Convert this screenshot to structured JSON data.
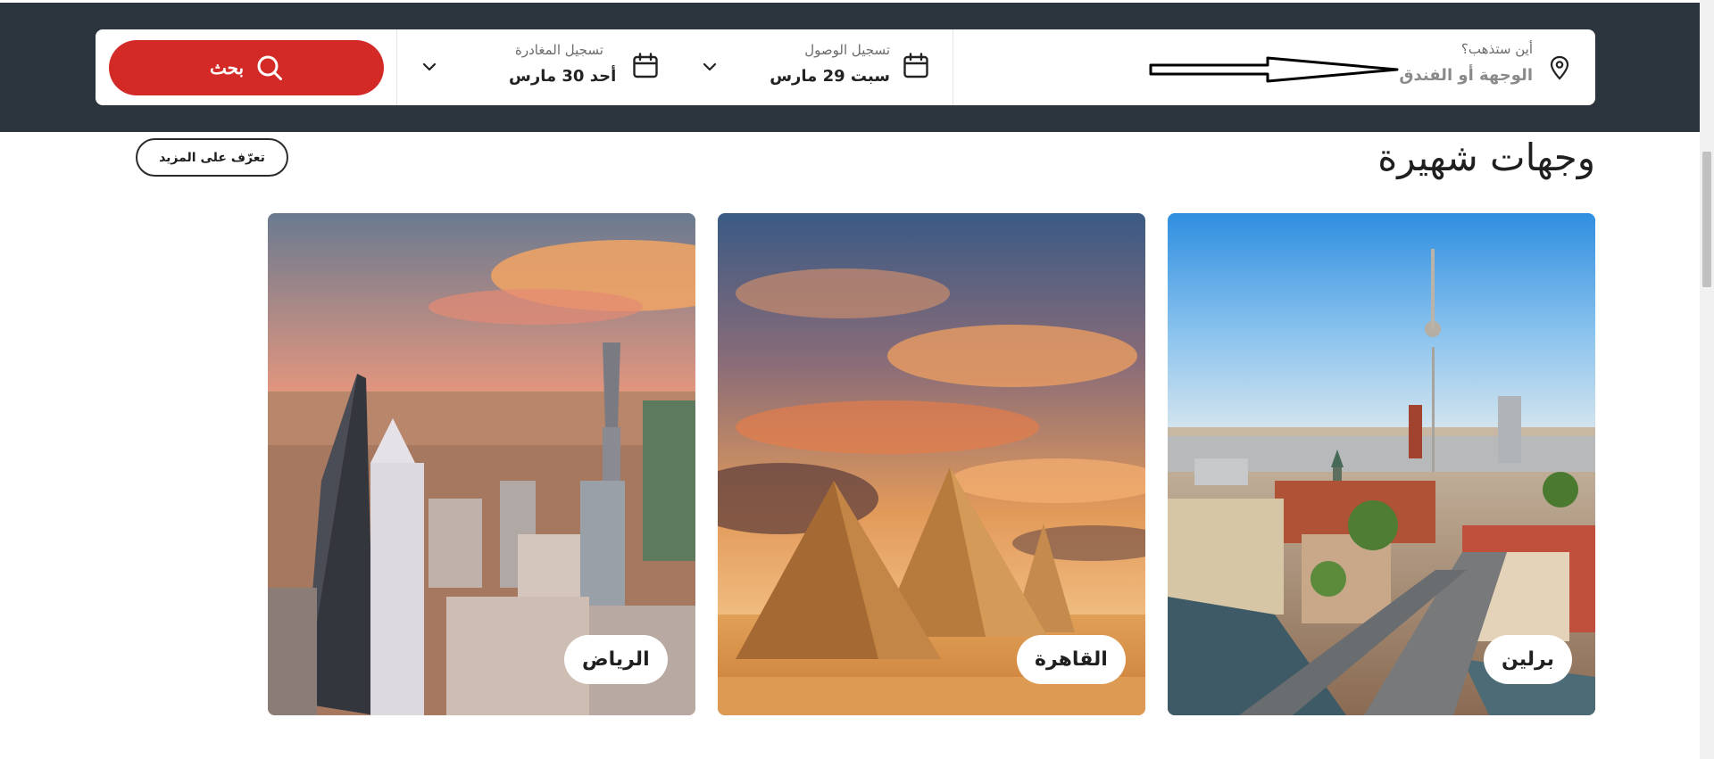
{
  "search": {
    "destination_label": "أين ستذهب؟",
    "destination_placeholder": "الوجهة أو الفندق",
    "checkin_label": "تسجيل الوصول",
    "checkin_value": "سبت 29 مارس",
    "checkout_label": "تسجيل المغادرة",
    "checkout_value": "أحد 30 مارس",
    "search_button_label": "بحث"
  },
  "section": {
    "title": "وجهات شهيرة",
    "learn_more_label": "تعرّف على المزيد"
  },
  "destinations": [
    {
      "name": "برلين"
    },
    {
      "name": "القاهرة"
    },
    {
      "name": "الرياض"
    }
  ],
  "icons": {
    "location": "location-pin-icon",
    "calendar": "calendar-icon",
    "chevron": "chevron-down-icon",
    "search": "search-icon",
    "arrow": "arrow-annotation-icon"
  },
  "colors": {
    "header_bg": "#2c353d",
    "accent": "#d32a27"
  }
}
